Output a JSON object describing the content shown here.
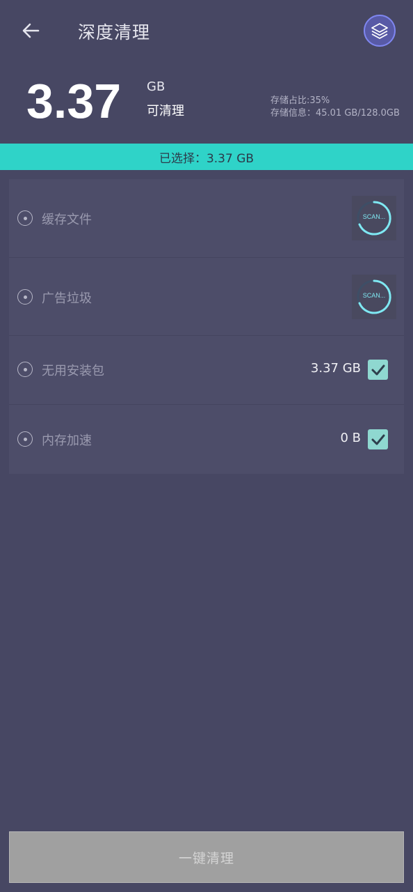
{
  "header": {
    "title": "深度清理",
    "back_icon": "arrow-left-icon",
    "layers_icon": "layers-icon"
  },
  "summary": {
    "amount": "3.37",
    "unit": "GB",
    "cleanable_label": "可清理",
    "storage_ratio": "存储占比:35%",
    "storage_info": "存储信息：45.01 GB/128.0GB"
  },
  "selected_bar": {
    "text": "已选择：3.37 GB",
    "color": "#2fd3c8"
  },
  "items": [
    {
      "label": "缓存文件",
      "status": "SCAN...",
      "state": "scanning"
    },
    {
      "label": "广告垃圾",
      "status": "SCAN...",
      "state": "scanning"
    },
    {
      "label": "无用安装包",
      "size": "3.37 GB",
      "checked": true
    },
    {
      "label": "内存加速",
      "size": "0 B",
      "checked": true
    }
  ],
  "clean_button": {
    "label": "一键清理"
  },
  "colors": {
    "background": "#474763",
    "accent": "#2fd3c8",
    "check": "#8fd8d0",
    "scan_ring": "#7fe8f2"
  }
}
